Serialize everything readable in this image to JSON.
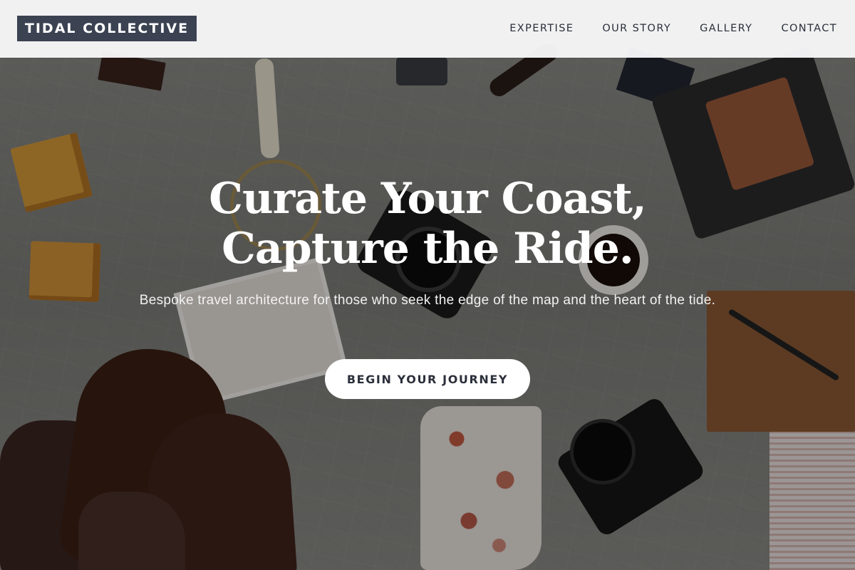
{
  "header": {
    "logo": "TIDAL COLLECTIVE",
    "nav": [
      {
        "label": "EXPERTISE"
      },
      {
        "label": "OUR STORY"
      },
      {
        "label": "GALLERY"
      },
      {
        "label": "CONTACT"
      }
    ]
  },
  "hero": {
    "title_line1": "Curate Your Coast,",
    "title_line2": "Capture the Ride.",
    "subtitle": "Bespoke travel architecture for those who seek the edge of the map and the heart of the tide.",
    "cta": "BEGIN YOUR JOURNEY"
  },
  "colors": {
    "logo_bg": "#3b4252",
    "header_bg": "#f6f6f7",
    "nav_text": "#2b2f3a",
    "cta_bg": "#ffffff",
    "cta_text": "#2a2f3a"
  }
}
